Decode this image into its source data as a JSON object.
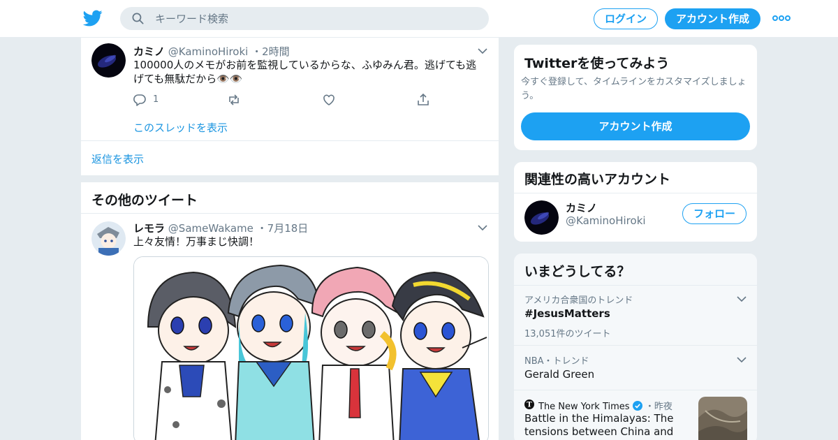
{
  "header": {
    "search_placeholder": "キーワード検索",
    "login_label": "ログイン",
    "signup_label": "アカウント作成"
  },
  "main": {
    "tweet1": {
      "name": "カミノ",
      "handle": "@KaminoHiroki",
      "time": "2時間",
      "text": "100000人のメモがお前を監視しているからな、ふゆみん君。逃げても逃げても無駄だから👁️👁️",
      "reply_count": "1",
      "thread_link": "このスレッドを表示"
    },
    "show_replies": "返信を表示",
    "more_tweets_title": "その他のツイート",
    "tweet2": {
      "name": "レモラ",
      "handle": "@SameWakame",
      "time": "7月18日",
      "text": "上々友情！万事まじ快調！"
    }
  },
  "sidebar": {
    "signup_card": {
      "title": "Twitterを使ってみよう",
      "subtitle": "今すぐ登録して、タイムラインをカスタマイズしましょう。",
      "button": "アカウント作成"
    },
    "related": {
      "title": "関連性の高いアカウント",
      "name": "カミノ",
      "handle": "@KaminoHiroki",
      "follow": "フォロー"
    },
    "trends": {
      "title": "いまどうしてる？",
      "items": [
        {
          "context": "アメリカ合衆国のトレンド",
          "name": "#JesusMatters",
          "count": "13,051件のツイート"
        },
        {
          "context": "NBA・トレンド",
          "name": "Gerald Green"
        }
      ],
      "news": {
        "source": "The New York Times",
        "time": "・昨夜",
        "headline": "Battle in the Himalayas: The tensions between China and India"
      }
    }
  },
  "colors": {
    "accent": "#1da1f2",
    "link": "#1b95e0",
    "text": "#14171a",
    "secondary": "#657786",
    "background": "#e6ecf0"
  }
}
